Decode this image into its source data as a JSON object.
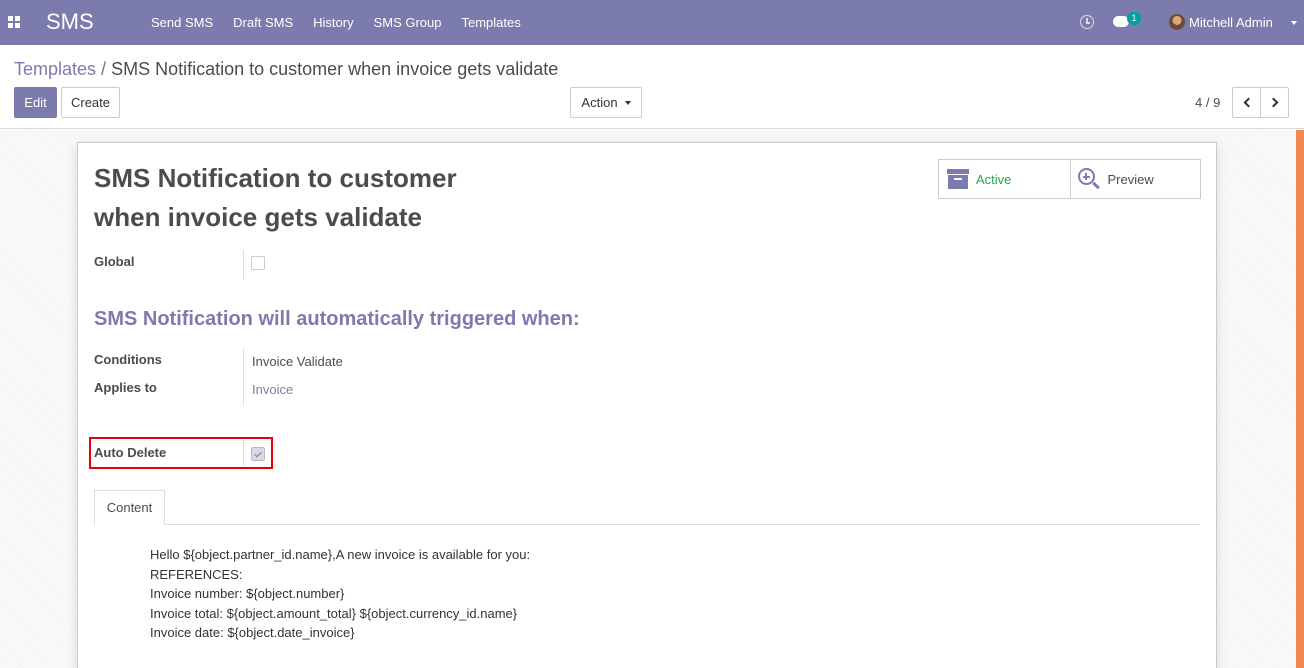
{
  "navbar": {
    "brand": "SMS",
    "menu": [
      "Send SMS",
      "Draft SMS",
      "History",
      "SMS Group",
      "Templates"
    ],
    "chat_badge": "1",
    "user_name": "Mitchell Admin"
  },
  "breadcrumb": {
    "parent": "Templates",
    "separator": "/",
    "current": "SMS Notification to customer when invoice gets validate"
  },
  "toolbar": {
    "edit_label": "Edit",
    "create_label": "Create",
    "action_label": "Action"
  },
  "pager": {
    "value": "4 / 9"
  },
  "form": {
    "title": "SMS Notification to customer when invoice gets validate",
    "active_label": "Active",
    "preview_label": "Preview",
    "global_label": "Global",
    "global_checked": false,
    "section_title": "SMS Notification will automatically triggered when:",
    "conditions_label": "Conditions",
    "conditions_value": "Invoice Validate",
    "applies_to_label": "Applies to",
    "applies_to_value": "Invoice",
    "auto_delete_label": "Auto Delete",
    "auto_delete_checked": true,
    "tab_label": "Content",
    "body": [
      "Hello ${object.partner_id.name},A new invoice is available for you:",
      "REFERENCES:",
      "Invoice number: ${object.number}",
      "Invoice total: ${object.amount_total} ${object.currency_id.name}",
      "Invoice date: ${object.date_invoice}"
    ]
  },
  "colors": {
    "brand": "#7c7bad",
    "active": "#28a745",
    "highlight": "#e3000f"
  }
}
